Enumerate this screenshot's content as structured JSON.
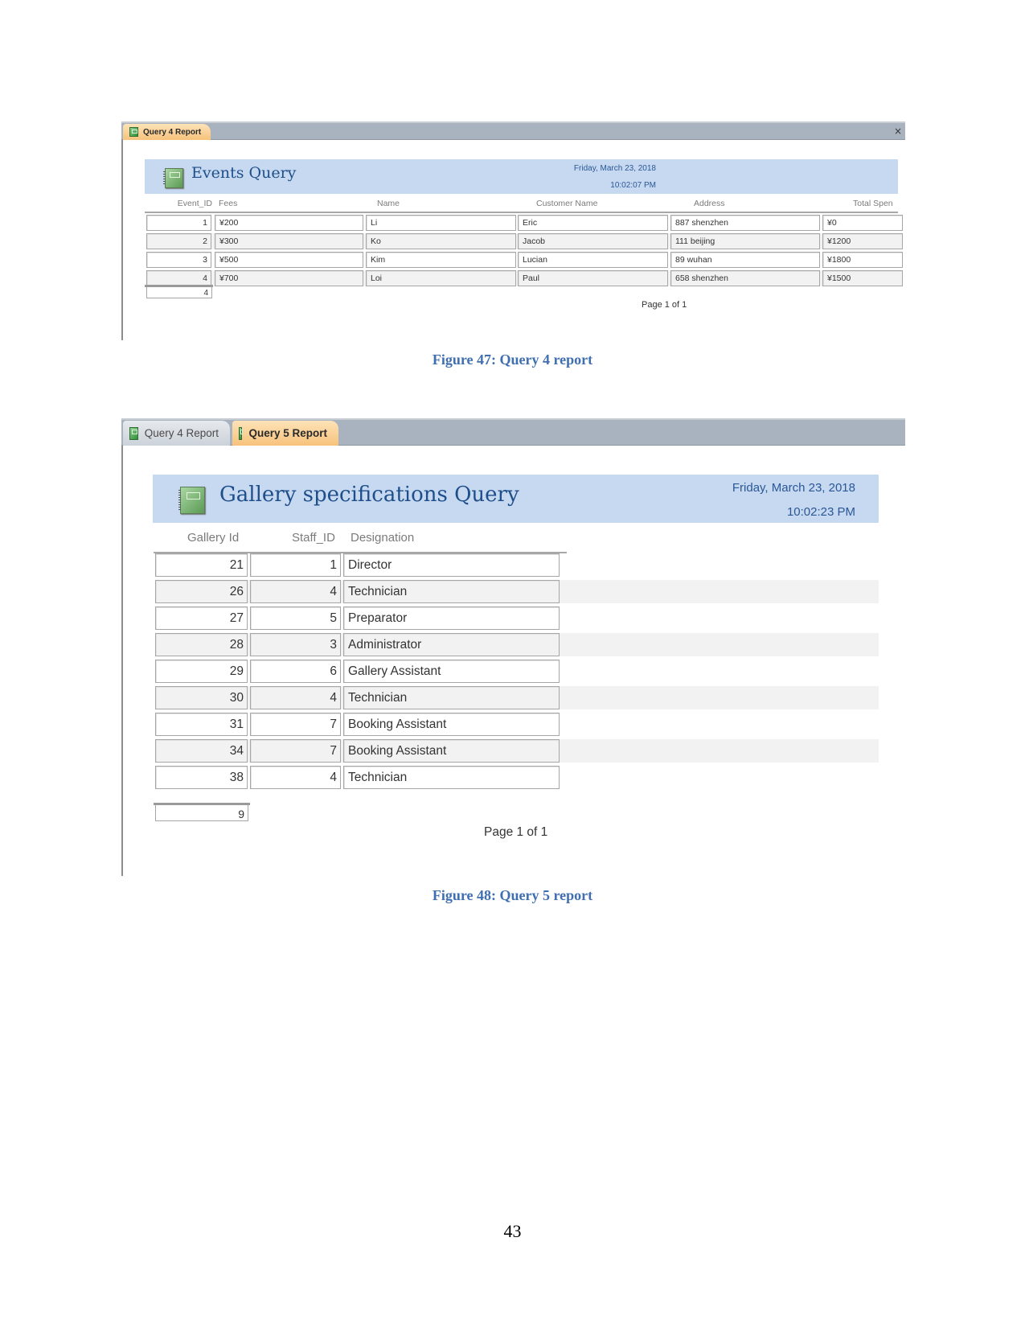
{
  "figure47": {
    "caption": "Figure 47: Query 4 report",
    "window": {
      "tabs": [
        {
          "label": "Query 4 Report",
          "active": true
        }
      ],
      "close_symbol": "×"
    },
    "report": {
      "title": "Events Query",
      "date": "Friday, March 23, 2018",
      "time": "10:02:07 PM",
      "columns": [
        "Event_ID",
        "Fees",
        "Name",
        "Customer Name",
        "Address",
        "Total Spen"
      ],
      "rows": [
        [
          "1",
          "¥200",
          "Li",
          "Eric",
          "887 shenzhen",
          "¥0"
        ],
        [
          "2",
          "¥300",
          "Ko",
          "Jacob",
          "111 beijing",
          "¥1200"
        ],
        [
          "3",
          "¥500",
          "Kim",
          "Lucian",
          "89 wuhan",
          "¥1800"
        ],
        [
          "4",
          "¥700",
          "Loi",
          "Paul",
          "658 shenzhen",
          "¥1500"
        ]
      ],
      "record_count": "4",
      "page_label": "Page 1 of 1"
    }
  },
  "figure48": {
    "caption": "Figure 48: Query 5 report",
    "window": {
      "tabs": [
        {
          "label": "Query 4 Report",
          "active": false
        },
        {
          "label": "Query 5 Report",
          "active": true
        }
      ]
    },
    "report": {
      "title": "Gallery specifications Query",
      "date": "Friday, March 23, 2018",
      "time": "10:02:23 PM",
      "columns": [
        "Gallery Id",
        "Staff_ID",
        "Designation"
      ],
      "rows": [
        [
          "21",
          "1",
          "Director"
        ],
        [
          "26",
          "4",
          "Technician"
        ],
        [
          "27",
          "5",
          "Preparator"
        ],
        [
          "28",
          "3",
          "Administrator"
        ],
        [
          "29",
          "6",
          "Gallery Assistant"
        ],
        [
          "30",
          "4",
          "Technician"
        ],
        [
          "31",
          "7",
          "Booking Assistant"
        ],
        [
          "34",
          "7",
          "Booking Assistant"
        ],
        [
          "38",
          "4",
          "Technician"
        ]
      ],
      "record_count": "9",
      "page_label": "Page 1 of 1"
    }
  },
  "page_number": "43",
  "colors": {
    "header_band": "#c6d9f0",
    "title_text": "#1f4f8b",
    "caption_text": "#3f6fb0",
    "active_tab": "#f7c27b",
    "tab_bar": "#a9b3bf"
  }
}
